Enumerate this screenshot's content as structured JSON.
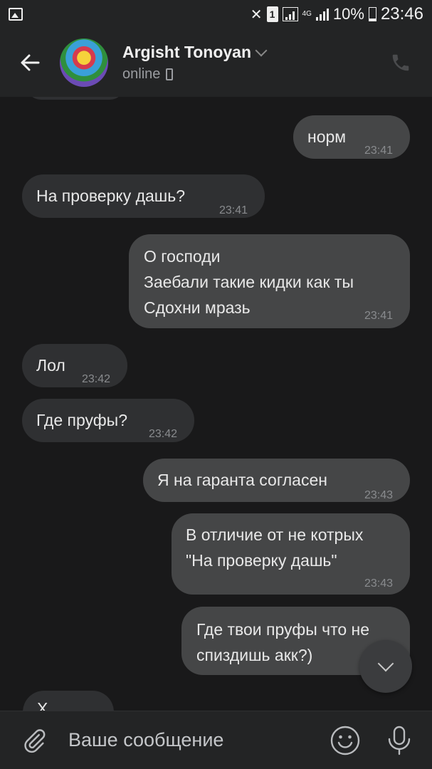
{
  "status_bar": {
    "sim_label": "1",
    "network_label": "4G",
    "battery": "10%",
    "time": "23:46"
  },
  "header": {
    "name": "Argisht Tonoyan",
    "status": "online"
  },
  "messages": [
    {
      "side": "out",
      "text": "норм",
      "time": "23:41"
    },
    {
      "side": "in",
      "text": "На проверку дашь?",
      "time": "23:41"
    },
    {
      "side": "out",
      "text": "О господи\nЗаебали такие кидки как ты\nСдохни мразь",
      "time": "23:41"
    },
    {
      "side": "in",
      "text": "Лол",
      "time": "23:42"
    },
    {
      "side": "in",
      "text": "Где пруфы?",
      "time": "23:42"
    },
    {
      "side": "out",
      "text": "Я на гаранта согласен",
      "time": "23:43"
    },
    {
      "side": "out",
      "text": "В отличие от не котрых\n\"На проверку дашь\"",
      "time": "23:43"
    },
    {
      "side": "out",
      "text": "Где твои пруфы что не\nспиздишь акк?)",
      "time": ""
    }
  ],
  "partial_bottom_text": "Х",
  "composer": {
    "placeholder": "Ваше сообщение"
  }
}
